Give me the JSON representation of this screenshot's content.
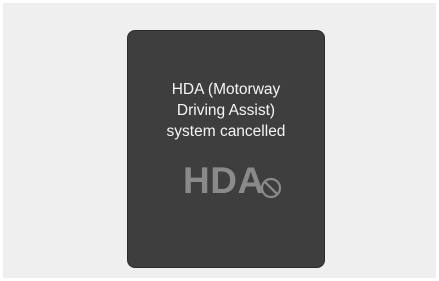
{
  "notification": {
    "message_lines": [
      "HDA (Motorway",
      "Driving Assist)",
      "system cancelled"
    ],
    "indicator_label": "HDA",
    "indicator_icon": "prohibited-icon"
  },
  "colors": {
    "screen_background": "#3e3e3e",
    "message_text": "#f4f4f4",
    "indicator": "#8a8a8a"
  }
}
